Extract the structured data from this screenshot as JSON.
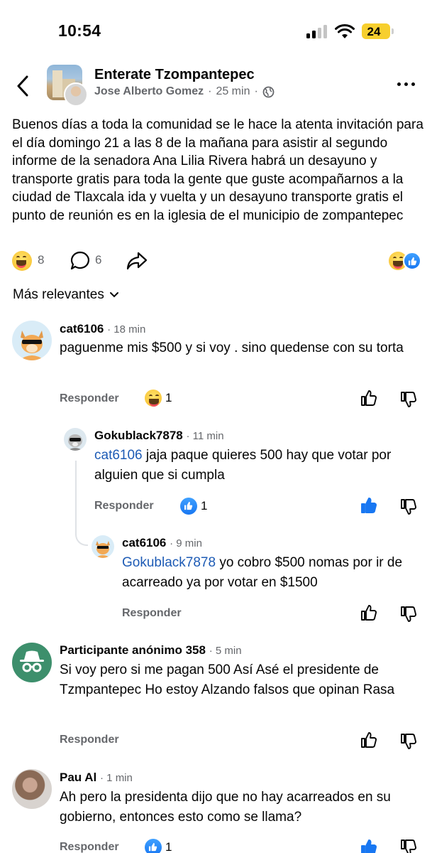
{
  "status_bar": {
    "time": "10:54",
    "battery": "24"
  },
  "header": {
    "group_name": "Enterate Tzompantepec",
    "author": "Jose Alberto Gomez",
    "time": "25 min",
    "separator": "·"
  },
  "post": {
    "text": "Buenos días a toda la comunidad se le hace la atenta invitación para el día domingo 21 a las 8 de la mañana para asistir al segundo informe de la senadora Ana Lilia Rivera habrá un desayuno y transporte gratis para toda la gente que guste acompañarnos a la ciudad de Tlaxcala ida y vuelta y un desayuno transporte gratis el punto de reunión es en la iglesia de el municipio de zompantepec",
    "reaction_count": "8",
    "comment_count": "6"
  },
  "sort": {
    "label": "Más relevantes"
  },
  "comments": [
    {
      "author": "cat6106",
      "time": "· 18 min",
      "text": "paguenme mis $500 y si voy . sino quedense con su torta",
      "reply_label": "Responder",
      "reaction_count": "1"
    },
    {
      "author": "Gokublack7878",
      "time": "· 11 min",
      "mention": "cat6106",
      "text": " jaja paque quieres 500 hay que votar por alguien que si cumpla",
      "reply_label": "Responder",
      "reaction_count": "1"
    },
    {
      "author": "cat6106",
      "time": "· 9 min",
      "mention": "Gokublack7878",
      "text": " yo cobro $500 nomas por ir de acarreado ya por votar en $1500",
      "reply_label": "Responder"
    },
    {
      "author": "Participante anónimo 358",
      "time": "· 5 min",
      "text": "Si voy pero si me pagan 500 Así Asé el presidente de Tzmpantepec Ho estoy Alzando falsos que opinan Rasa",
      "reply_label": "Responder"
    },
    {
      "author": "Pau Al",
      "time": "· 1 min",
      "text": "Ah pero la presidenta dijo que no hay acarreados en su gobierno, entonces esto como se llama?",
      "reply_label": "Responder",
      "reaction_count": "1"
    }
  ],
  "colors": {
    "link": "#1d5bb5",
    "like_blue": "#1877f2",
    "secondary_text": "#65676b",
    "battery": "#f7cf2e"
  },
  "icons": [
    "back-arrow-icon",
    "globe-icon",
    "more-icon",
    "comment-icon",
    "share-icon",
    "haha-icon",
    "like-icon",
    "chevron-down-icon",
    "thumbs-up-icon",
    "thumbs-down-icon",
    "anonymous-icon"
  ]
}
